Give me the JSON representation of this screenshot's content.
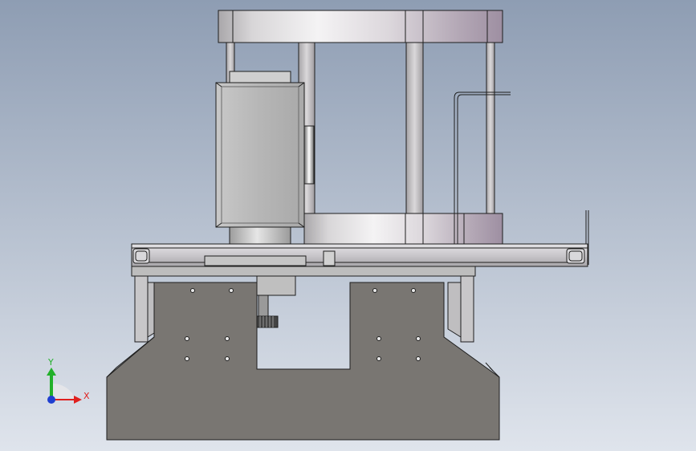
{
  "viewport": {
    "background_top": "#8e9db3",
    "background_bottom": "#dfe4ec"
  },
  "triad": {
    "x_label": "X",
    "y_label": "Y",
    "x_color": "#e0201e",
    "y_color": "#22b02a",
    "z_color": "#1f3fd0"
  },
  "model": {
    "base_color": "#797672",
    "frame_color": "#c7c4c4",
    "motor_color": "#b4b4b4",
    "ring_color": "#c9c7cc",
    "accent_color": "#9d8fa0"
  }
}
